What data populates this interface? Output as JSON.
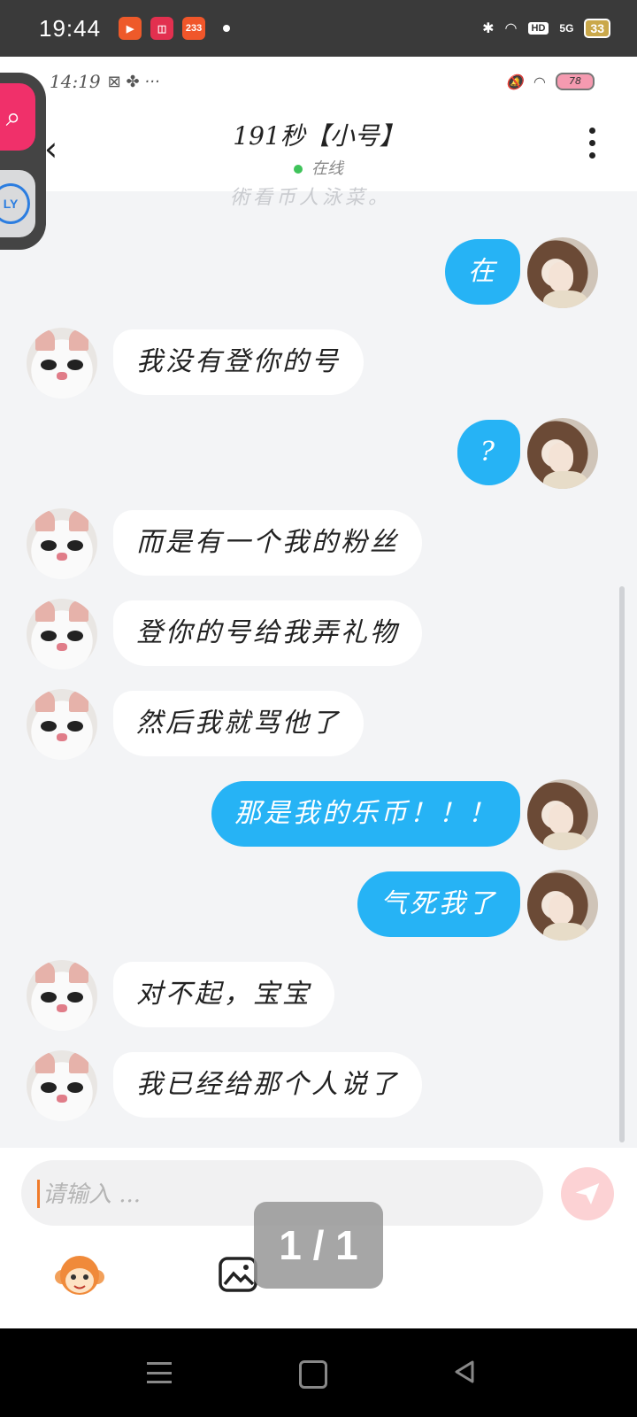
{
  "system_status": {
    "time": "19:44",
    "apps": [
      "video-app",
      "shop-app",
      "233-app"
    ],
    "app_233_label": "233",
    "network": "5G",
    "hd": "HD",
    "battery": "33"
  },
  "inner_status": {
    "time": "14:19",
    "icons": "⊠ ✤ ···",
    "battery": "78"
  },
  "chat": {
    "title": "191秒【小号】",
    "status": "在线",
    "faded_text": "術看币人泳菜。"
  },
  "messages": [
    {
      "side": "out",
      "text": "在"
    },
    {
      "side": "in",
      "text": "我没有登你的号"
    },
    {
      "side": "out",
      "text": "?"
    },
    {
      "side": "in",
      "text": "而是有一个我的粉丝"
    },
    {
      "side": "in",
      "text": "登你的号给我弄礼物"
    },
    {
      "side": "in",
      "text": "然后我就骂他了"
    },
    {
      "side": "out",
      "text": "那是我的乐币！！！"
    },
    {
      "side": "out",
      "text": "气死我了"
    },
    {
      "side": "in",
      "text": "对不起，宝宝"
    },
    {
      "side": "in",
      "text": "我已经给那个人说了"
    }
  ],
  "input": {
    "placeholder": "请输入 ..."
  },
  "overlay": {
    "page_indicator": "1 / 1"
  },
  "colors": {
    "outgoing_bubble": "#26b3f5",
    "incoming_bubble": "#ffffff",
    "background": "#f3f4f6",
    "online_dot": "#3fc35a"
  }
}
